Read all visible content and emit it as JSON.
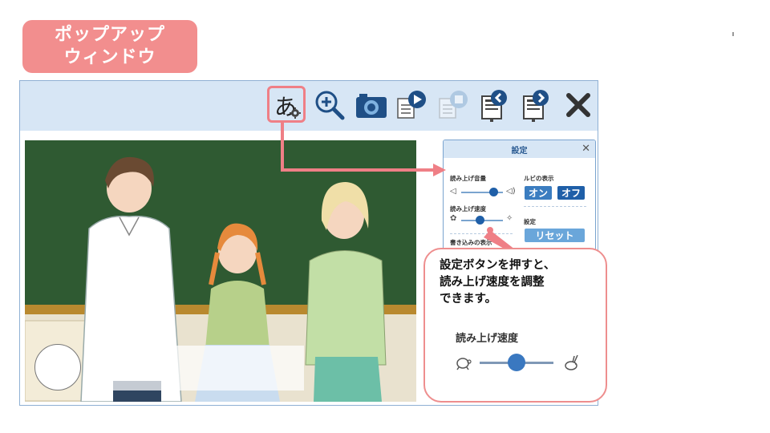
{
  "badge": {
    "line1": "ポップアップ",
    "line2": "ウィンドウ"
  },
  "toolbar": {
    "icons": [
      "settings-kana-icon",
      "zoom-in-icon",
      "camera-icon",
      "read-play-icon",
      "read-stop-icon",
      "page-prev-icon",
      "page-next-icon",
      "close-icon"
    ],
    "settings_glyph": "あ"
  },
  "settings_panel": {
    "title": "設定",
    "volume_label": "読み上げ音量",
    "ruby_label": "ルビの表示",
    "ruby_on": "オン",
    "ruby_off": "オフ",
    "speed_label": "読み上げ速度",
    "settings_label": "設定",
    "reset_label": "リセット",
    "writing_label": "書き込みの表示",
    "volume_level": 0.78,
    "speed_level": 0.45
  },
  "callout": {
    "line1": "設定ボタンを押すと、",
    "line2": "読み上げ速度を調整",
    "line3": "できます。",
    "speed_label": "読み上げ速度",
    "speed_level": 0.5
  },
  "colors": {
    "accent": "#f28e8e",
    "toolbar": "#d7e6f5",
    "blue": "#3b7dc0",
    "board": "#2f5a32"
  }
}
